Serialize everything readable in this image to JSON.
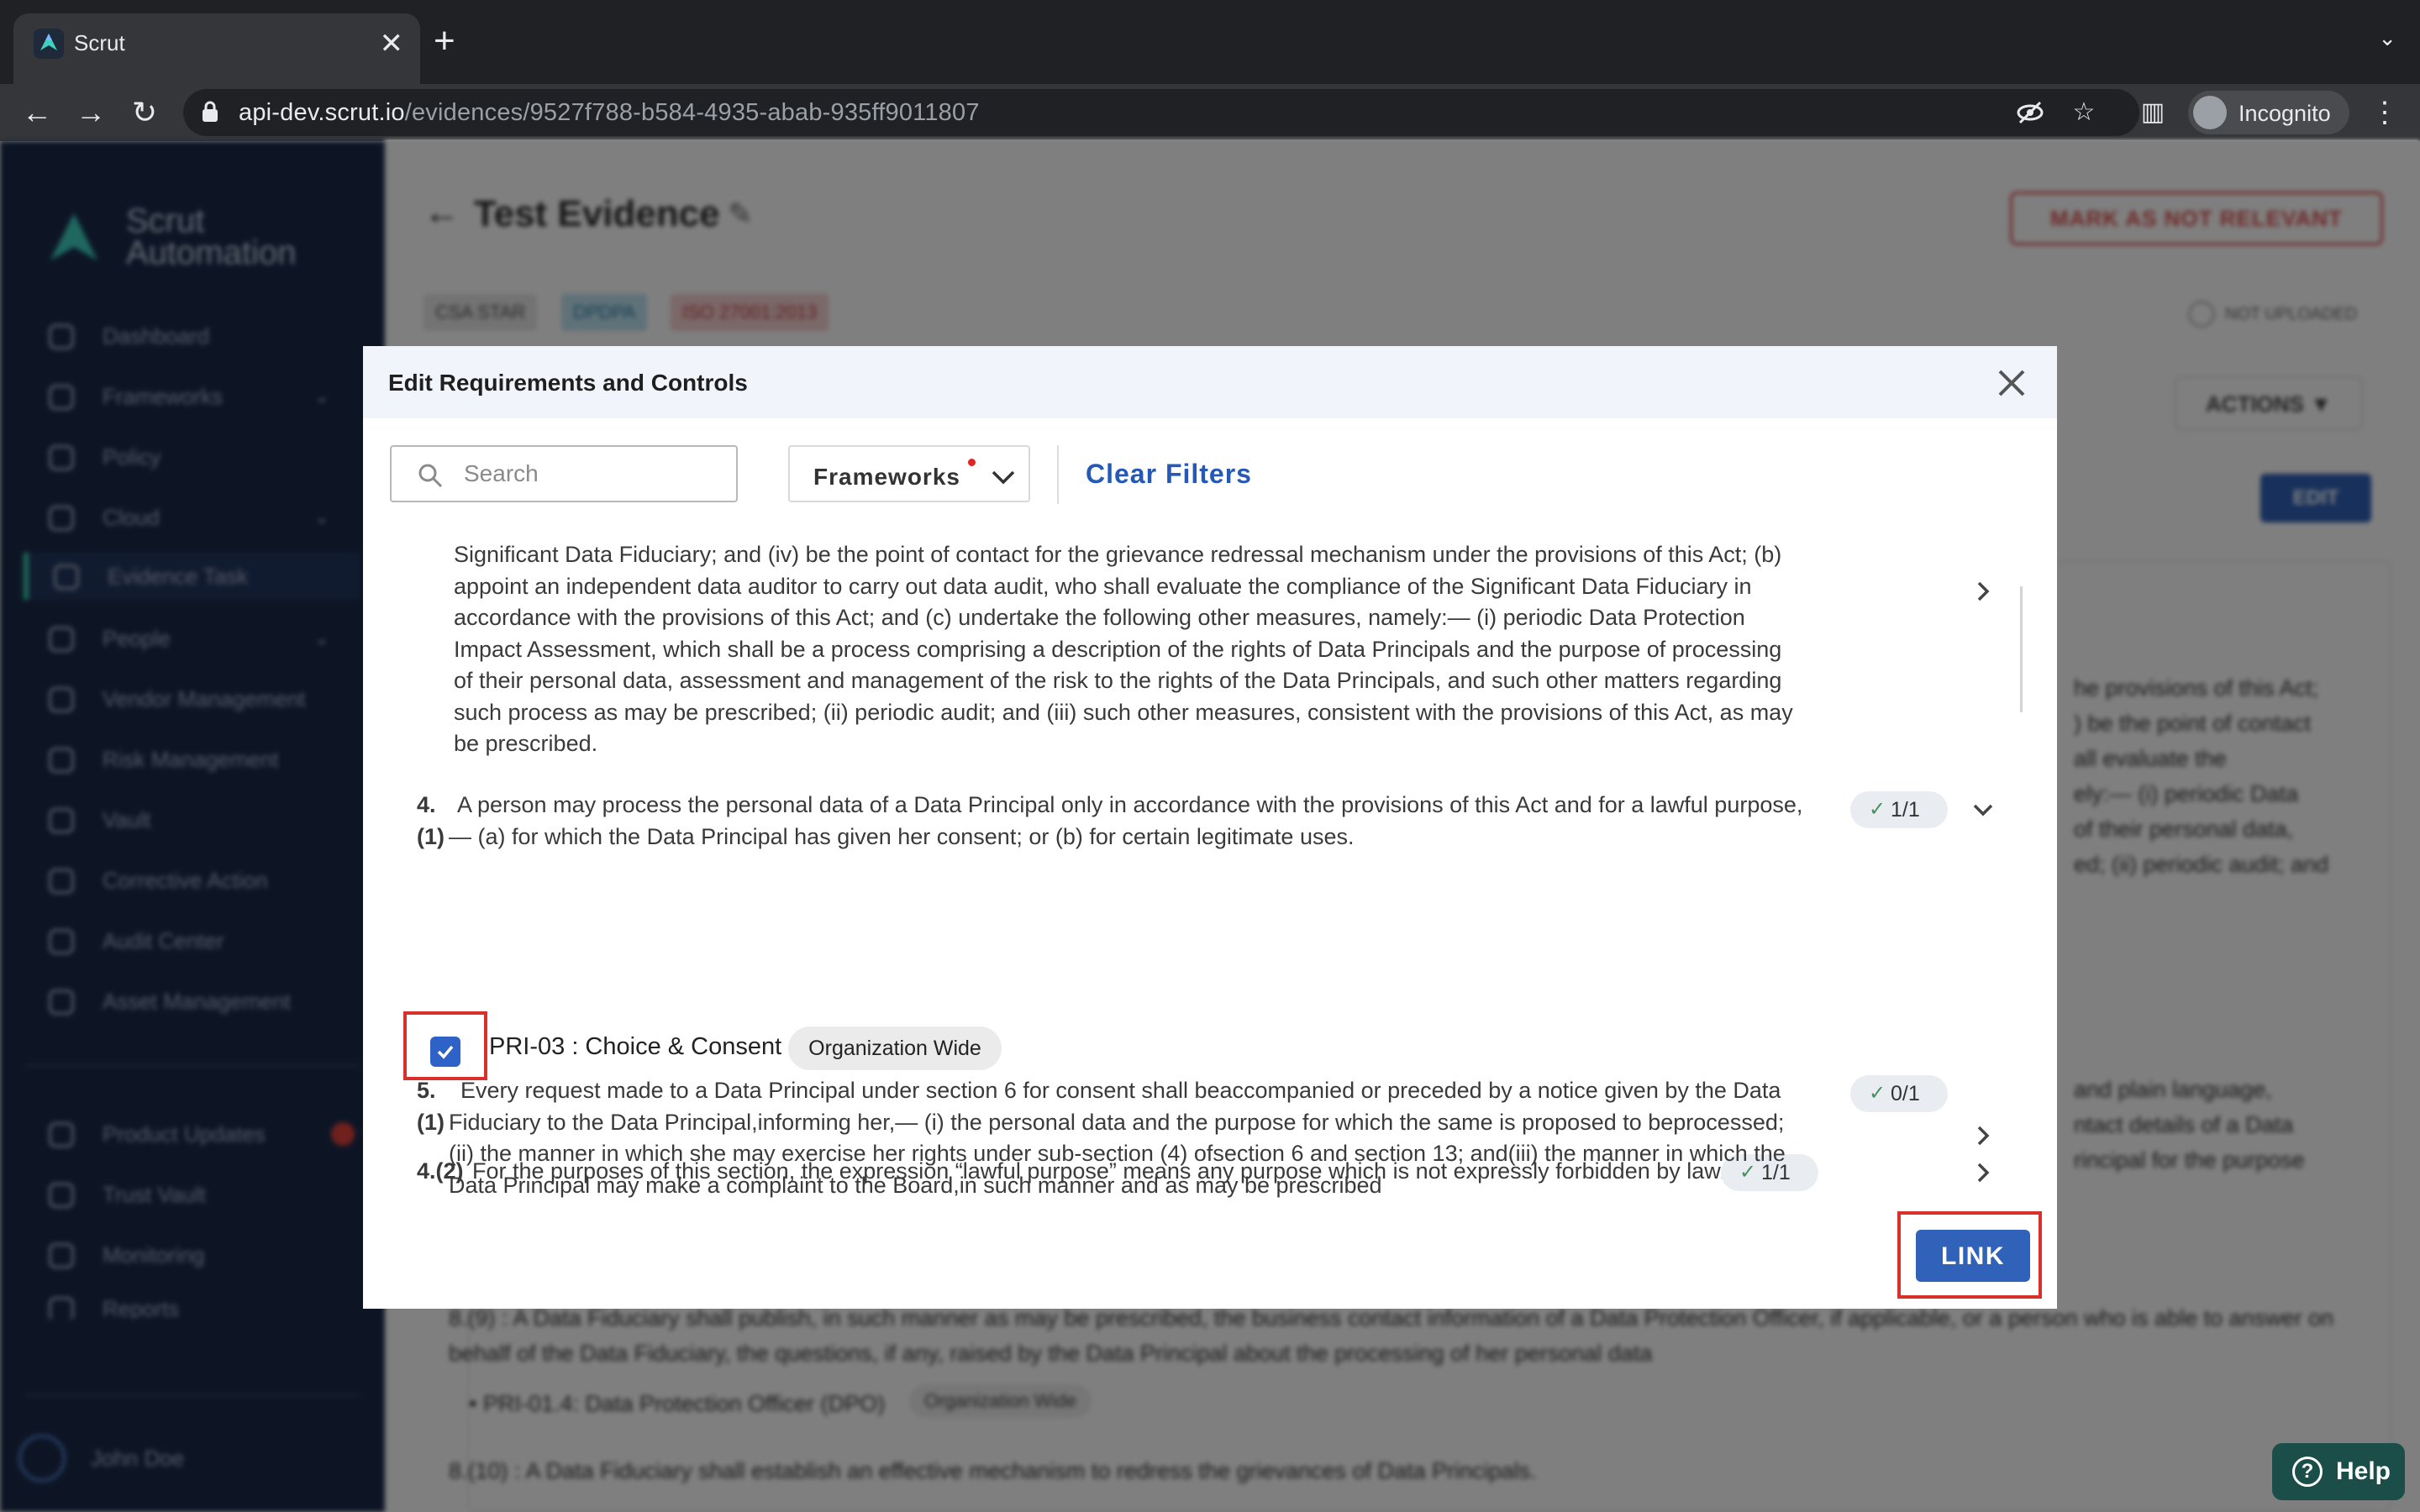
{
  "browser": {
    "tab_title": "Scrut",
    "url_host": "api-dev.scrut.io",
    "url_path": "/evidences/9527f788-b584-4935-abab-935ff9011807",
    "profile_label": "Incognito"
  },
  "sidebar": {
    "brand_line1": "Scrut",
    "brand_line2": "Automation",
    "items": [
      {
        "label": "Dashboard"
      },
      {
        "label": "Frameworks"
      },
      {
        "label": "Policy"
      },
      {
        "label": "Cloud"
      },
      {
        "label": "Evidence Task"
      },
      {
        "label": "People"
      },
      {
        "label": "Vendor Management"
      },
      {
        "label": "Risk Management"
      },
      {
        "label": "Vault"
      },
      {
        "label": "Corrective Action"
      },
      {
        "label": "Audit Center"
      },
      {
        "label": "Asset Management"
      },
      {
        "label": "Product Updates"
      },
      {
        "label": "Trust Vault"
      },
      {
        "label": "Monitoring"
      },
      {
        "label": "Reports"
      }
    ],
    "user_name": "John Doe"
  },
  "page": {
    "title": "Test Evidence",
    "mark_button": "MARK AS NOT RELEVANT",
    "tags": [
      "CSA STAR",
      "DPDPA",
      "ISO 27001:2013"
    ],
    "status": "NOT UPLOADED",
    "actions_label": "ACTIONS ▼",
    "edit_label": "EDIT",
    "bg_right_lines": [
      "he provisions of this Act;",
      ") be the point of contact",
      "all evaluate the",
      "ely:— (i) periodic Data",
      "of their personal data,",
      "ed; (ii) periodic audit; and"
    ],
    "bg_right_lines2": [
      "and plain language,",
      "ntact details of a Data",
      "rincipal for the purpose"
    ],
    "bg_req_8_9": "8.(9) : A Data Fiduciary shall publish, in such manner as may be prescribed, the business contact information of a Data Protection Officer, if applicable, or a person who is able to answer on behalf of the Data Fiduciary, the questions, if any, raised by the Data Principal about the processing of her personal data",
    "bg_ctrl_8_9": "PRI-01.4: Data Protection Officer (DPO)",
    "bg_ctrl_8_9_scope": "Organization Wide",
    "bg_req_8_10": "8.(10) : A Data Fiduciary shall establish an effective mechanism to redress the grievances of Data Principals."
  },
  "help_label": "Help",
  "modal": {
    "title": "Edit Requirements and Controls",
    "search_placeholder": "Search",
    "frameworks_label": "Frameworks",
    "clear_filters_label": "Clear Filters",
    "link_label": "LINK",
    "requirements": [
      {
        "number": "",
        "text": "Significant Data Fiduciary; and (iv) be the point of contact for the grievance redressal mechanism under the provisions of this Act; (b) appoint an independent data auditor to carry out data audit, who shall evaluate the compliance of the Significant Data Fiduciary in accordance with the provisions of this Act; and (c) undertake the following other measures, namely:— (i) periodic Data Protection Impact Assessment, which shall be a process comprising a description of the rights of Data Principals and the purpose of processing of their personal data, assessment and management of the risk to the rights of the Data Principals, and such other matters regarding such process as may be prescribed; (ii) periodic audit; and (iii) such other measures, consistent with the provisions of this Act, as may be prescribed."
      },
      {
        "number_a": "4.",
        "number_b": "(1)",
        "text": "A person may process the personal data of a Data Principal only in accordance with the provisions of this Act and for a lawful purpose,— (a) for which the Data Principal has given her consent; or (b) for certain legitimate uses.",
        "count": "1/1",
        "control": {
          "label": "PRI-03 : Choice & Consent",
          "scope": "Organization Wide",
          "checked": true
        }
      },
      {
        "number": "4.(2)",
        "text": "For the purposes of this section, the expression “lawful purpose” means any purpose which is not expressly forbidden by law.",
        "count": "1/1"
      },
      {
        "number_a": "5.",
        "number_b": "(1)",
        "text": "Every request made to a Data Principal under section 6 for consent shall beaccompanied or preceded by a notice given by the Data Fiduciary to the Data Principal,informing her,— (i) the personal data and the purpose for which the same is proposed to beprocessed; (ii) the manner in which she may exercise her rights under sub-section (4) ofsection 6 and section 13; and(iii) the manner in which the Data Principal may make a complaint to the Board,in such manner and as may be prescribed",
        "count": "0/1"
      }
    ]
  }
}
